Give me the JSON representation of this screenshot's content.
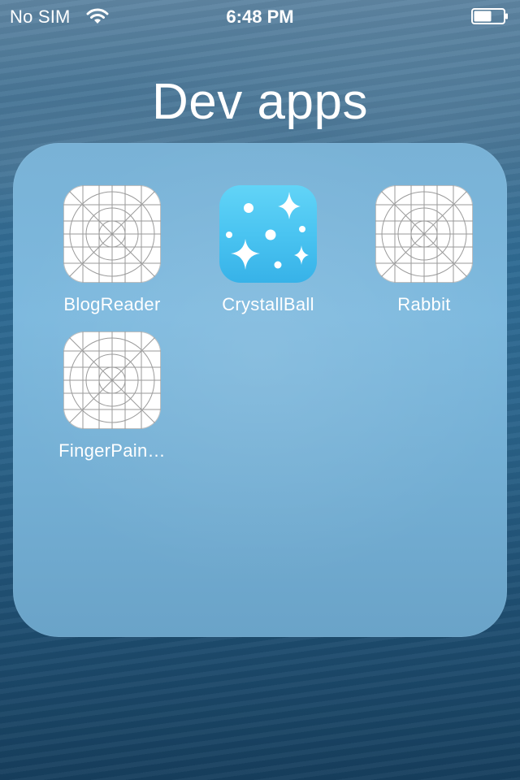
{
  "status_bar": {
    "carrier": "No SIM",
    "time": "6:48 PM",
    "wifi_icon": "wifi-icon",
    "battery_icon": "battery-icon",
    "battery_level": 0.6
  },
  "folder": {
    "title": "Dev apps",
    "apps": [
      {
        "label": "BlogReader",
        "icon": "placeholder-grid-icon"
      },
      {
        "label": "CrystallBall",
        "icon": "sparkles-icon"
      },
      {
        "label": "Rabbit",
        "icon": "placeholder-grid-icon"
      },
      {
        "label": "FingerPain…",
        "icon": "placeholder-grid-icon"
      }
    ]
  },
  "colors": {
    "text": "#ffffff",
    "crystal_icon": "#4ac4f1",
    "folder_panel": "#7db9de"
  }
}
